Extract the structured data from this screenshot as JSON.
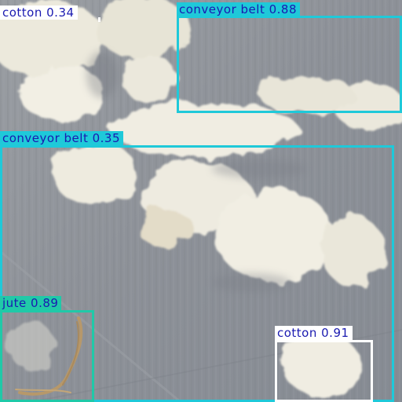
{
  "image": {
    "subject": "cotton and jute fibres on a grey conveyor belt",
    "colors": {
      "belt": "#8f9399",
      "cotton": "#efece0",
      "jute": "#b8a070",
      "label_text": "#1a1ab0"
    }
  },
  "detections": [
    {
      "label": "cotton 0.34",
      "class": "cotton",
      "score": 0.34,
      "color": "#ffffff"
    },
    {
      "label": "conveyor belt 0.88",
      "class": "conveyor belt",
      "score": 0.88,
      "color": "#1fc9d9"
    },
    {
      "label": "conveyor belt 0.35",
      "class": "conveyor belt",
      "score": 0.35,
      "color": "#1fc9d9"
    },
    {
      "label": "jute 0.89",
      "class": "jute",
      "score": 0.89,
      "color": "#20c9a8"
    },
    {
      "label": "cotton 0.91",
      "class": "cotton",
      "score": 0.91,
      "color": "#ffffff"
    }
  ]
}
